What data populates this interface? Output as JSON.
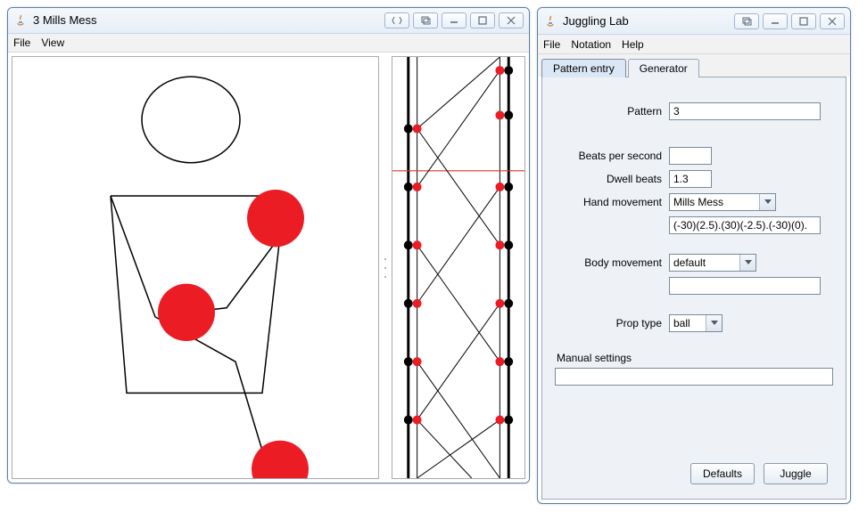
{
  "left_window": {
    "title": "3 Mills Mess",
    "menu": [
      "File",
      "View"
    ]
  },
  "right_window": {
    "title": "Juggling Lab",
    "menu": [
      "File",
      "Notation",
      "Help"
    ],
    "tabs": [
      {
        "label": "Pattern entry"
      },
      {
        "label": "Generator"
      }
    ],
    "form": {
      "pattern_label": "Pattern",
      "pattern_value": "3",
      "bps_label": "Beats per second",
      "bps_value": "",
      "dwell_label": "Dwell beats",
      "dwell_value": "1.3",
      "handmove_label": "Hand movement",
      "handmove_value": "Mills Mess",
      "handmove_string": "(-30)(2.5).(30)(-2.5).(-30)(0).",
      "bodymove_label": "Body movement",
      "bodymove_value": "default",
      "bodymove_string": "",
      "prop_label": "Prop type",
      "prop_value": "ball",
      "manual_label": "Manual settings",
      "manual_value": ""
    },
    "buttons": {
      "defaults": "Defaults",
      "juggle": "Juggle"
    }
  }
}
